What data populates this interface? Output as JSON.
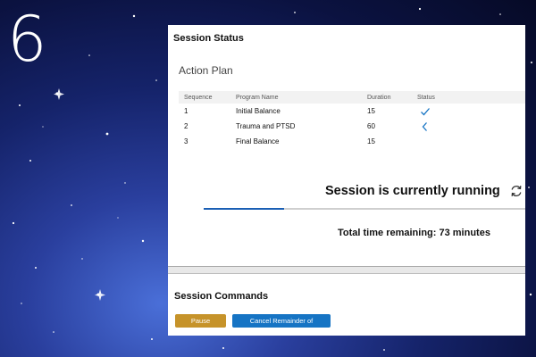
{
  "step_number": "6",
  "window": {
    "title": "Session Status"
  },
  "action_plan": {
    "heading": "Action Plan",
    "columns": [
      "Sequence",
      "Program Name",
      "Duration",
      "Status"
    ],
    "rows": [
      {
        "sequence": "1",
        "program": "Initial Balance",
        "duration": "15",
        "status_icon": "check-icon"
      },
      {
        "sequence": "2",
        "program": "Trauma and PTSD",
        "duration": "60",
        "status_icon": "chevron-left-icon"
      },
      {
        "sequence": "3",
        "program": "Final Balance",
        "duration": "15",
        "status_icon": ""
      }
    ]
  },
  "session": {
    "running_text": "Session is currently running",
    "progress": 0.25,
    "time_remaining": "Total time remaining: 73 minutes",
    "refresh_icon": "refresh-icon"
  },
  "commands": {
    "heading": "Session Commands",
    "pause_label": "Pause Session",
    "cancel_label": "Cancel Remainder of Session"
  },
  "colors": {
    "accent_blue": "#1674c4",
    "progress_blue": "#1a5fb4",
    "pause_gold": "#c6932a"
  }
}
